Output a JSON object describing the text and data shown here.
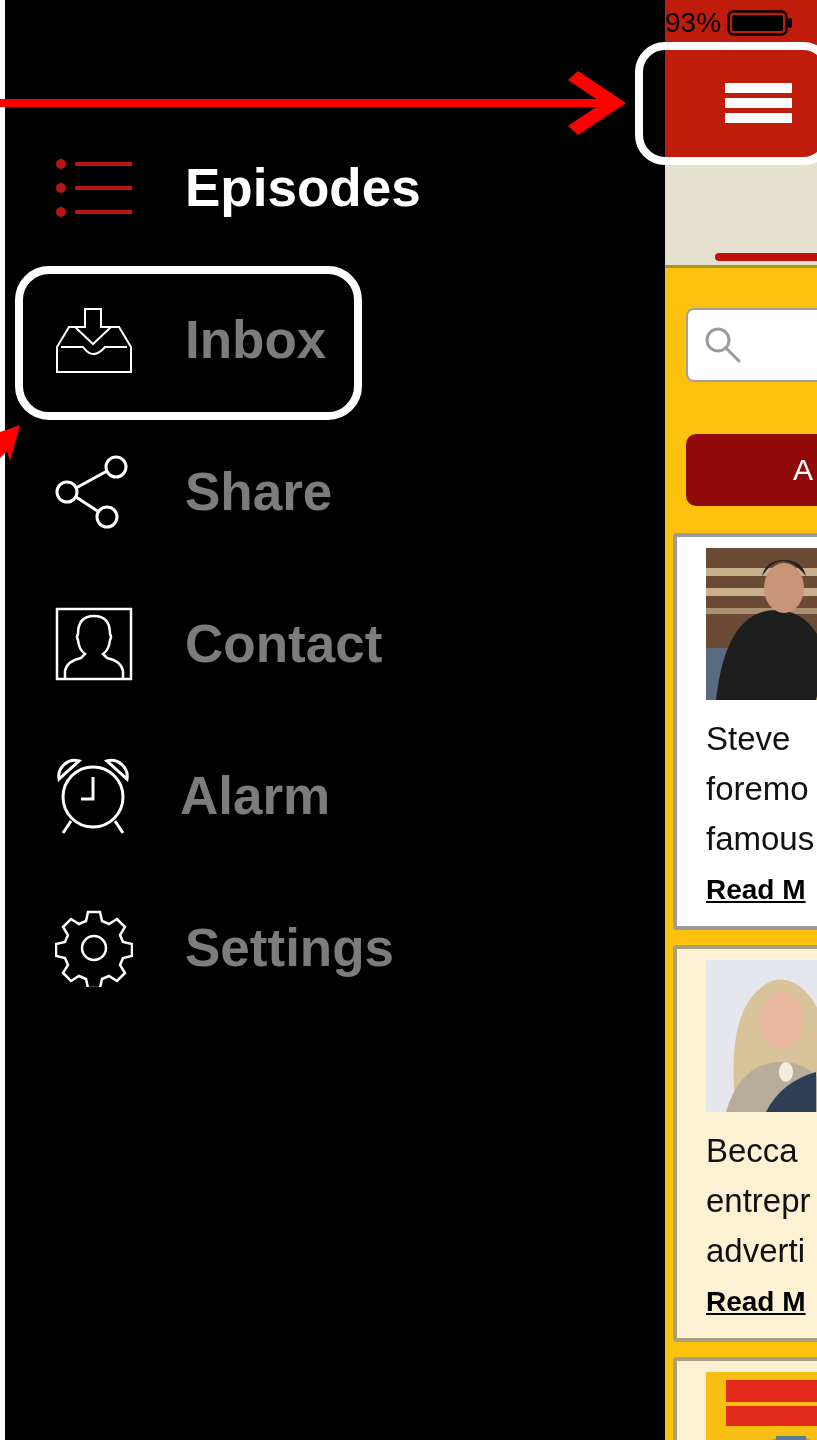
{
  "status_bar": {
    "battery": "93%"
  },
  "drawer": {
    "items": [
      {
        "label": "Episodes",
        "kind": "episodes",
        "selected": true
      },
      {
        "label": "Inbox",
        "kind": "inbox",
        "selected": false
      },
      {
        "label": "Share",
        "kind": "share",
        "selected": false
      },
      {
        "label": "Contact",
        "kind": "contact",
        "selected": false
      },
      {
        "label": "Alarm",
        "kind": "alarm",
        "selected": false
      },
      {
        "label": "Settings",
        "kind": "settings",
        "selected": false
      }
    ]
  },
  "filter_button": {
    "label": "A"
  },
  "episodes": [
    {
      "kind": "person",
      "color": "#ffffff",
      "lines": [
        "Steve",
        "foremo",
        "famous"
      ],
      "link": "Read M"
    },
    {
      "kind": "person",
      "color": "#fdf1d3",
      "lines": [
        "Becca",
        "entrepr",
        "adverti"
      ],
      "link": "Read M"
    },
    {
      "kind": "artwork",
      "color": "#fdf1d3"
    }
  ]
}
